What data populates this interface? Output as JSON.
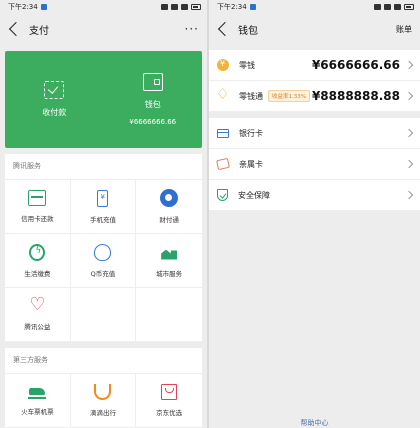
{
  "left": {
    "status": {
      "time": "下午2:34"
    },
    "nav": {
      "title": "支付",
      "more": "···"
    },
    "top": {
      "pay_label": "收付款",
      "wallet_label": "钱包",
      "wallet_balance": "¥6666666.66"
    },
    "tencent_section": {
      "title": "腾讯服务",
      "items": [
        {
          "label": "信用卡还款",
          "icon": "credit-card-icon"
        },
        {
          "label": "手机充值",
          "icon": "phone-topup-icon"
        },
        {
          "label": "财付通",
          "icon": "tenpay-icon"
        },
        {
          "label": "生活缴费",
          "icon": "utility-bill-icon"
        },
        {
          "label": "Q币充值",
          "icon": "qq-coin-icon"
        },
        {
          "label": "城市服务",
          "icon": "city-service-icon"
        },
        {
          "label": "腾讯公益",
          "icon": "charity-heart-icon"
        }
      ]
    },
    "third_section": {
      "title": "第三方服务",
      "items": [
        {
          "label": "火车票机票",
          "icon": "train-icon"
        },
        {
          "label": "滴滴出行",
          "icon": "didi-icon"
        },
        {
          "label": "京东优选",
          "icon": "shopping-bag-icon"
        }
      ]
    }
  },
  "right": {
    "status": {
      "time": "下午2:34"
    },
    "nav": {
      "title": "钱包",
      "bill": "账单"
    },
    "rows": {
      "change": {
        "label": "零钱",
        "amount": "¥6666666.66"
      },
      "licaitong": {
        "label": "零钱通",
        "badge": "收益率1.33%",
        "amount": "¥8888888.88"
      }
    },
    "group2": {
      "bank_card": "银行卡",
      "family_card": "亲属卡",
      "security": "安全保障"
    },
    "help": "帮助中心"
  },
  "colors": {
    "green": "#3cad5f",
    "accent_blue": "#3a7bd5",
    "badge_orange": "#c88a2c"
  }
}
